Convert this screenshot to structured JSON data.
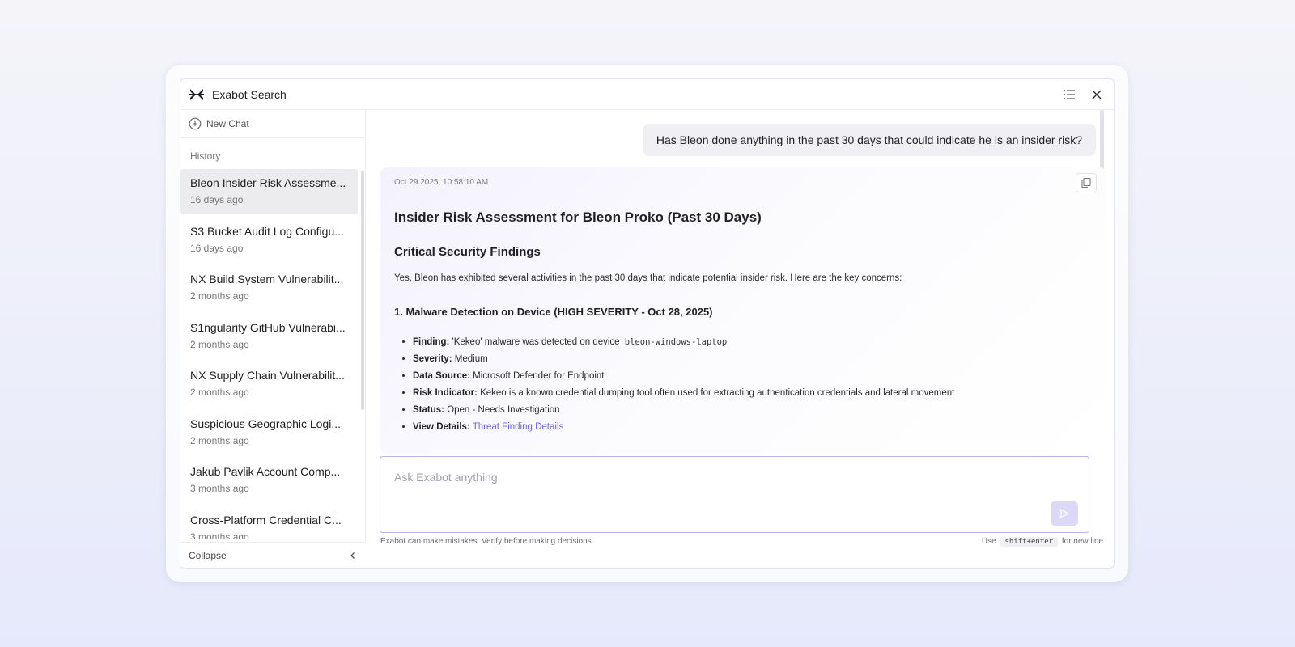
{
  "window": {
    "title": "Exabot Search"
  },
  "sidebar": {
    "new_chat_label": "New Chat",
    "history_label": "History",
    "items": [
      {
        "title": "Bleon Insider Risk Assessme...",
        "time": "16 days ago"
      },
      {
        "title": "S3 Bucket Audit Log Configu...",
        "time": "16 days ago"
      },
      {
        "title": "NX Build System Vulnerabilit...",
        "time": "2 months ago"
      },
      {
        "title": "S1ngularity GitHub Vulnerabi...",
        "time": "2 months ago"
      },
      {
        "title": "NX Supply Chain Vulnerabilit...",
        "time": "2 months ago"
      },
      {
        "title": "Suspicious Geographic Logi...",
        "time": "2 months ago"
      },
      {
        "title": "Jakub Pavlik Account Comp...",
        "time": "3 months ago"
      },
      {
        "title": "Cross-Platform Credential C...",
        "time": "3 months ago"
      }
    ],
    "collapse_label": "Collapse"
  },
  "chat": {
    "user_message": "Has Bleon done anything in the past 30 days that could indicate he is an insider risk?",
    "answer": {
      "timestamp": "Oct 29 2025, 10:58:10 AM",
      "heading": "Insider Risk Assessment for Bleon Proko (Past 30 Days)",
      "subheading": "Critical Security Findings",
      "intro": "Yes, Bleon has exhibited several activities in the past 30 days that indicate potential insider risk. Here are the key concerns:",
      "section_title": "1. Malware Detection on Device (HIGH SEVERITY - Oct 28, 2025)",
      "bullets": {
        "finding_label": "Finding:",
        "finding_text": "'Kekeo' malware was detected on device",
        "finding_code": "bleon-windows-laptop",
        "severity_label": "Severity:",
        "severity_text": "Medium",
        "source_label": "Data Source:",
        "source_text": "Microsoft Defender for Endpoint",
        "risk_label": "Risk Indicator:",
        "risk_text": "Kekeo is a known credential dumping tool often used for extracting authentication credentials and lateral movement",
        "status_label": "Status:",
        "status_text": "Open - Needs Investigation",
        "details_label": "View Details:",
        "details_link": "Threat Finding Details"
      }
    }
  },
  "composer": {
    "placeholder": "Ask Exabot anything",
    "disclaimer": "Exabot can make mistakes. Verify before making decisions.",
    "hint_prefix": "Use",
    "hint_key": "shift+enter",
    "hint_suffix": "for new line"
  },
  "colors": {
    "accent": "#6b63e6",
    "send_button": "#dcd9f7",
    "active_item": "#ececef"
  }
}
